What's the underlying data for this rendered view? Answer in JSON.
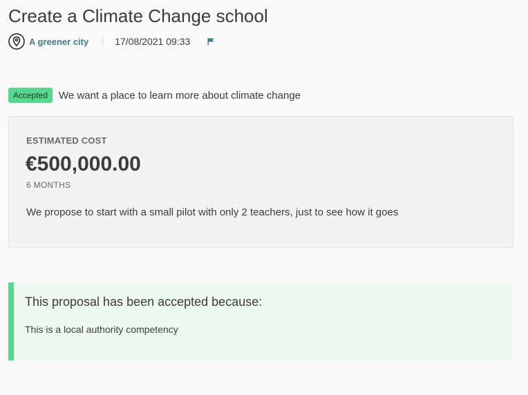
{
  "proposal": {
    "title": "Create a Climate Change school",
    "scope": "A greener city",
    "date": "17/08/2021 09:33",
    "status_badge": "Accepted",
    "summary": "We want a place to learn more about climate change"
  },
  "icons": {
    "location": "map-pin-icon",
    "report": "flag-icon"
  },
  "cost": {
    "label": "ESTIMATED COST",
    "value": "€500,000.00",
    "duration": "6 MONTHS",
    "description": "We propose to start with a small pilot with only 2 teachers, just to see how it goes"
  },
  "answer": {
    "title": "This proposal has been accepted because:",
    "body": "This is a local authority competency"
  },
  "colors": {
    "accent_green": "#57d68d",
    "link": "#3e7c86",
    "text": "#3d393c"
  }
}
